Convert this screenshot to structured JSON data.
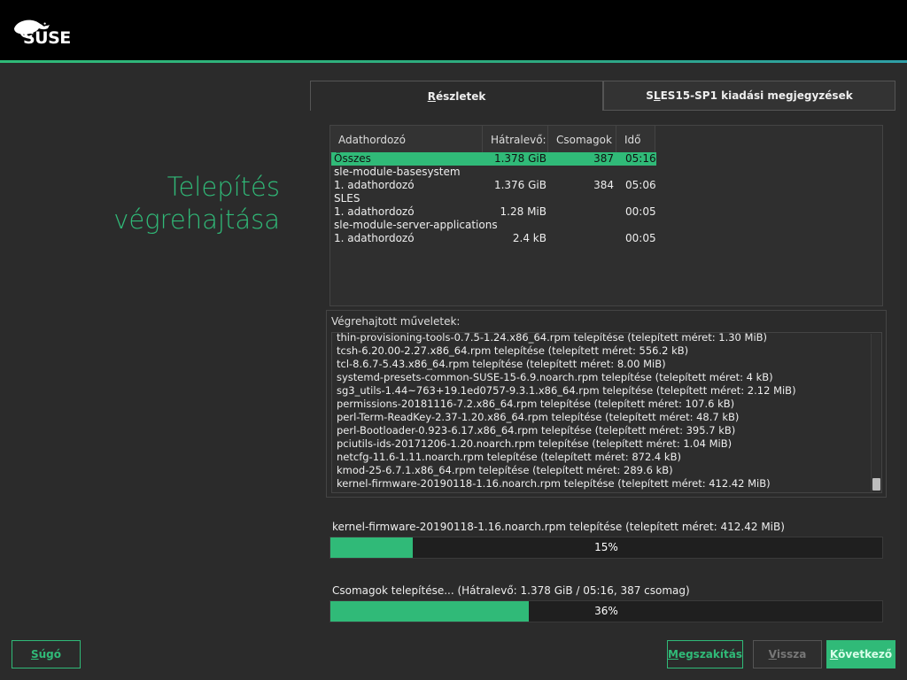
{
  "brand": {
    "logo_text": "SUSE",
    "accent_color": "#30ba78"
  },
  "page_title": {
    "line1": "Telepítés",
    "line2": "végrehajtása"
  },
  "tabs": [
    {
      "label": "Részletek",
      "underline": "R",
      "rest": "észletek",
      "active": true
    },
    {
      "label": "SLES15-SP1 kiadási megjegyzések",
      "pre": "S",
      "underline": "L",
      "rest": "ES15-SP1 kiadási megjegyzések",
      "active": false
    }
  ],
  "media_table": {
    "columns": [
      "Adathordozó",
      "Hátralevő:",
      "Csomagok",
      "Idő"
    ],
    "rows": [
      {
        "name": "Összes",
        "remaining": "1.378 GiB",
        "packages": "387",
        "time": "05:16",
        "selected": true
      },
      {
        "group": "sle-module-basesystem"
      },
      {
        "name": "1. adathordozó",
        "remaining": "1.376 GiB",
        "packages": "384",
        "time": "05:06"
      },
      {
        "group": "SLES"
      },
      {
        "name": "1. adathordozó",
        "remaining": "1.28 MiB",
        "packages": "",
        "time": "00:05"
      },
      {
        "group": "sle-module-server-applications"
      },
      {
        "name": "1. adathordozó",
        "remaining": "2.4 kB",
        "packages": "",
        "time": "00:05"
      }
    ]
  },
  "actions": {
    "label": "Végrehajtott műveletek:",
    "lines": [
      "thin-provisioning-tools-0.7.5-1.24.x86_64.rpm telepítése (telepített méret: 1.30 MiB)",
      "tcsh-6.20.00-2.27.x86_64.rpm telepítése (telepített méret: 556.2 kB)",
      "tcl-8.6.7-5.43.x86_64.rpm telepítése (telepített méret: 8.00 MiB)",
      "systemd-presets-common-SUSE-15-6.9.noarch.rpm telepítése (telepített méret: 4 kB)",
      "sg3_utils-1.44~763+19.1ed0757-9.3.1.x86_64.rpm telepítése (telepített méret: 2.12 MiB)",
      "permissions-20181116-7.2.x86_64.rpm telepítése (telepített méret: 107.6 kB)",
      "perl-Term-ReadKey-2.37-1.20.x86_64.rpm telepítése (telepített méret: 48.7 kB)",
      "perl-Bootloader-0.923-6.17.x86_64.rpm telepítése (telepített méret: 395.7 kB)",
      "pciutils-ids-20171206-1.20.noarch.rpm telepítése (telepített méret: 1.04 MiB)",
      "netcfg-11.6-1.11.noarch.rpm telepítése (telepített méret: 872.4 kB)",
      "kmod-25-6.7.1.x86_64.rpm telepítése (telepített méret: 289.6 kB)",
      "kernel-firmware-20190118-1.16.noarch.rpm telepítése (telepített méret: 412.42 MiB)"
    ]
  },
  "package_progress": {
    "label": "kernel-firmware-20190118-1.16.noarch.rpm telepítése (telepített méret: 412.42 MiB)",
    "percent": 15,
    "text": "15%"
  },
  "total_progress": {
    "label": "Csomagok telepítése... (Hátralevő: 1.378 GiB / 05:16, 387 csomag)",
    "percent": 36,
    "text": "36%"
  },
  "buttons": {
    "help": {
      "underline": "S",
      "rest": "úgó",
      "label": "Súgó"
    },
    "abort": {
      "underline": "M",
      "rest": "egszakítás",
      "label": "Megszakítás"
    },
    "back": {
      "pre": "",
      "underline": "V",
      "rest": "issza",
      "label": "Vissza"
    },
    "next": {
      "underline": "K",
      "rest": "övetkező",
      "label": "Következő"
    }
  }
}
